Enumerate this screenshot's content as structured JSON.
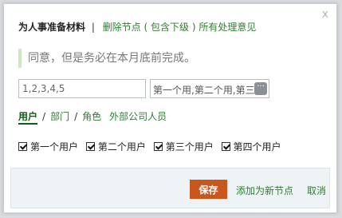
{
  "dialog": {
    "close_glyph": "x",
    "header": {
      "title": "为人事准备材料",
      "separator": "|",
      "link": "删除节点 ( 包含下级 ) 所有处理意见"
    },
    "opinion": "同意，但是务必在本月底前完成。",
    "node_input": {
      "value": "1,2,3,4,5"
    },
    "user_input": {
      "value": "第一个用,第二个用,第三个",
      "more_glyph": "···"
    },
    "tabs": [
      {
        "label": "用户",
        "active": true
      },
      {
        "label": "部门"
      },
      {
        "label": "角色"
      },
      {
        "label": "外部公司人员"
      }
    ],
    "users": [
      {
        "label": "第一个用户",
        "checked": true
      },
      {
        "label": "第二个用户",
        "checked": true
      },
      {
        "label": "第三个用户",
        "checked": true
      },
      {
        "label": "第四个用户",
        "checked": true
      }
    ],
    "footer": {
      "save_label": "保存",
      "add_node_label": "添加为新节点",
      "cancel_label": "取消"
    }
  },
  "colors": {
    "accent_green": "#2f7d32",
    "save_orange": "#c8571f",
    "footer_bg": "#eef3f6"
  }
}
